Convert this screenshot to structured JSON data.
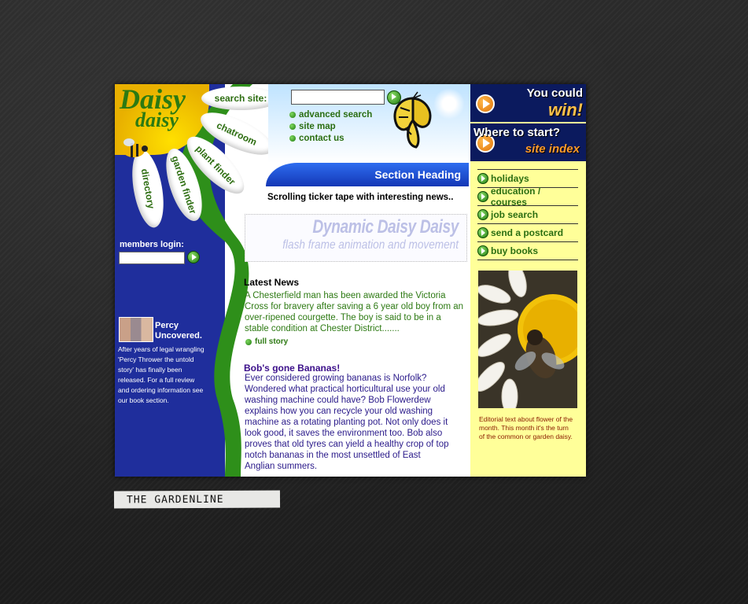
{
  "logo": {
    "line1": "Daisy",
    "line2": "daisy"
  },
  "petals": {
    "search": "search site:",
    "chatroom": "chatroom",
    "plant_finder": "plant finder",
    "garden_finder": "garden finder",
    "directory": "directory"
  },
  "search": {
    "value": "",
    "placeholder": ""
  },
  "nav_links": [
    "advanced search",
    "site map",
    "contact us"
  ],
  "section_heading": "Section Heading",
  "ticker": "Scrolling ticker tape with interesting news..",
  "flash": {
    "line1": "Dynamic Daisy Daisy",
    "line2": "flash frame animation and movement"
  },
  "members": {
    "label": "members login:",
    "value": ""
  },
  "percy": {
    "title": "Percy Uncovered.",
    "text": "After years of legal wrangling 'Percy Thrower the untold story' has finally been released.  For a full review and ordering information  see our book section."
  },
  "latest_news": {
    "heading": "Latest News",
    "text": "A  Chesterfield man has been awarded the Victoria Cross for bravery after saving a 6 year old boy from an over-ripened courgette.  The boy is said to be in a stable condition at Chester District.......",
    "full_story": "full story"
  },
  "bob": {
    "heading": "Bob's gone Bananas!",
    "text": "Ever considered growing bananas is Norfolk? Wondered what practical horticultural use your old washing machine could have? Bob Flowerdew explains how you can  recycle your old  washing machine as a rotating planting pot. Not only does it look good, it saves the environment too.  Bob also proves that old tyres can yield a healthy crop of top notch bananas in the most unsettled of East Anglian summers."
  },
  "banners": {
    "win": {
      "line1": "You could",
      "line2": "win!"
    },
    "start": {
      "line1": "Where to start?",
      "line2": "site index"
    }
  },
  "menu": [
    "holidays",
    "education / courses",
    "job search",
    "send a postcard",
    "buy books"
  ],
  "editorial": "Editorial text about flower of the month.   This month it's the turn of the common or garden daisy.",
  "footer_label": "THE GARDENLINE",
  "colors": {
    "blue": "#1f2e9c",
    "green": "#2e7a14",
    "yellow": "#ffff99",
    "heading_blue": "#1437b5"
  }
}
